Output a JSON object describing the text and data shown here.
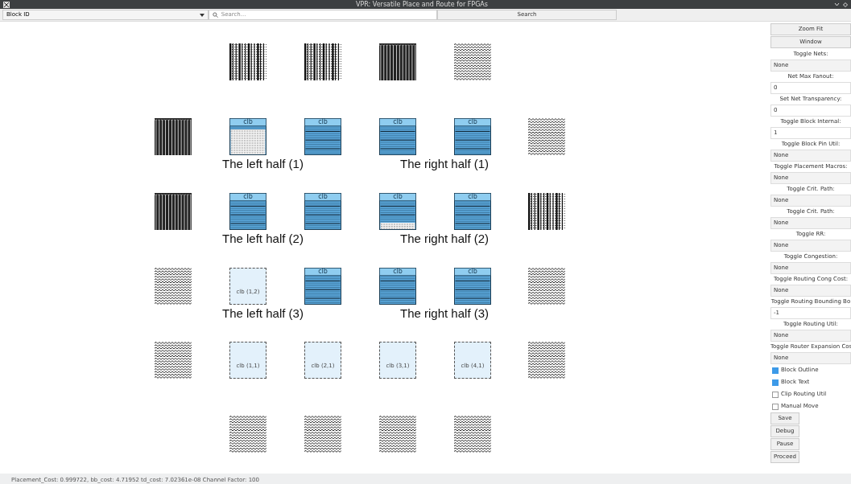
{
  "window": {
    "title": "VPR: Versatile Place and Route for FPGAs"
  },
  "toolbar": {
    "block_select": "Block ID",
    "search": {
      "placeholder": "Search..."
    },
    "search_button": "Search"
  },
  "grid": [
    {
      "cells": [
        {
          "kind": "none"
        },
        {
          "kind": "io_vertical"
        },
        {
          "kind": "io_vertical"
        },
        {
          "kind": "io_dense"
        },
        {
          "kind": "io_wavy"
        },
        {
          "kind": "none"
        }
      ]
    },
    {
      "cells": [
        {
          "kind": "io_dense"
        },
        {
          "kind": "clb_partial",
          "label": "clb"
        },
        {
          "kind": "clb",
          "label": "clb"
        },
        {
          "kind": "clb",
          "label": "clb"
        },
        {
          "kind": "clb",
          "label": "clb"
        },
        {
          "kind": "io_wavy"
        }
      ],
      "left_caption": "The left half (1)",
      "right_caption": "The right half (1)"
    },
    {
      "cells": [
        {
          "kind": "io_dense"
        },
        {
          "kind": "clb",
          "label": "clb"
        },
        {
          "kind": "clb",
          "label": "clb"
        },
        {
          "kind": "clb_bottom",
          "label": "clb"
        },
        {
          "kind": "clb",
          "label": "clb"
        },
        {
          "kind": "io_vertical"
        }
      ],
      "left_caption": "The left half (2)",
      "right_caption": "The right half (2)"
    },
    {
      "cells": [
        {
          "kind": "io_wavy"
        },
        {
          "kind": "empty",
          "label": "clb (1,2)"
        },
        {
          "kind": "clb",
          "label": "clb"
        },
        {
          "kind": "clb",
          "label": "clb"
        },
        {
          "kind": "clb",
          "label": "clb"
        },
        {
          "kind": "io_wavy"
        }
      ],
      "left_caption": "The left half (3)",
      "right_caption": "The right half (3)"
    },
    {
      "cells": [
        {
          "kind": "io_wavy"
        },
        {
          "kind": "empty",
          "label": "clb (1,1)"
        },
        {
          "kind": "empty",
          "label": "clb (2,1)"
        },
        {
          "kind": "empty",
          "label": "clb (3,1)"
        },
        {
          "kind": "empty",
          "label": "clb (4,1)"
        },
        {
          "kind": "io_wavy"
        }
      ]
    },
    {
      "cells": [
        {
          "kind": "none"
        },
        {
          "kind": "io_wavy"
        },
        {
          "kind": "io_wavy"
        },
        {
          "kind": "io_wavy"
        },
        {
          "kind": "io_wavy"
        },
        {
          "kind": "none"
        }
      ]
    }
  ],
  "panel": [
    {
      "kind": "button",
      "text": "Zoom Fit"
    },
    {
      "kind": "button",
      "text": "Window"
    },
    {
      "kind": "label",
      "text": "Toggle Nets:"
    },
    {
      "kind": "select",
      "text": "None"
    },
    {
      "kind": "label",
      "text": "Net Max Fanout:"
    },
    {
      "kind": "spin",
      "text": "0"
    },
    {
      "kind": "label",
      "text": "Set Net Transparency:"
    },
    {
      "kind": "spin",
      "text": "0"
    },
    {
      "kind": "label",
      "text": "Toggle Block Internal:"
    },
    {
      "kind": "spin",
      "text": "1"
    },
    {
      "kind": "label",
      "text": "Toggle Block Pin Util:"
    },
    {
      "kind": "select",
      "text": "None"
    },
    {
      "kind": "label",
      "text": "Toggle Placement Macros:"
    },
    {
      "kind": "select",
      "text": "None"
    },
    {
      "kind": "label",
      "text": "Toggle Crit. Path:"
    },
    {
      "kind": "select",
      "text": "None"
    },
    {
      "kind": "label",
      "text": "Toggle Crit. Path:"
    },
    {
      "kind": "select",
      "text": "None"
    },
    {
      "kind": "label",
      "text": "Toggle RR:"
    },
    {
      "kind": "select",
      "text": "None"
    },
    {
      "kind": "label",
      "text": "Toggle Congestion:"
    },
    {
      "kind": "select",
      "text": "None"
    },
    {
      "kind": "label",
      "text": "Toggle Routing Cong Cost:"
    },
    {
      "kind": "select",
      "text": "None"
    },
    {
      "kind": "label",
      "text": "Toggle Routing Bounding Bo"
    },
    {
      "kind": "spin",
      "text": "-1"
    },
    {
      "kind": "label",
      "text": "Toggle Routing Util:"
    },
    {
      "kind": "select",
      "text": "None"
    },
    {
      "kind": "label",
      "text": "Toggle Router Expansion Cos"
    },
    {
      "kind": "select",
      "text": "None"
    },
    {
      "kind": "checkbox",
      "text": "Block Outline",
      "checked": true
    },
    {
      "kind": "checkbox",
      "text": "Block Text",
      "checked": true
    },
    {
      "kind": "checkbox",
      "text": "Clip Routing Util",
      "checked": false
    },
    {
      "kind": "checkbox",
      "text": "Manual Move",
      "checked": false
    },
    {
      "kind": "small_button",
      "text": "Save"
    },
    {
      "kind": "small_button",
      "text": "Debug"
    },
    {
      "kind": "small_button",
      "text": "Pause"
    },
    {
      "kind": "small_button",
      "text": "Proceed"
    }
  ],
  "status_bar": "Placement_Cost: 0.999722, bb_cost: 4.71952 td_cost: 7.02361e-08 Channel Factor: 100"
}
